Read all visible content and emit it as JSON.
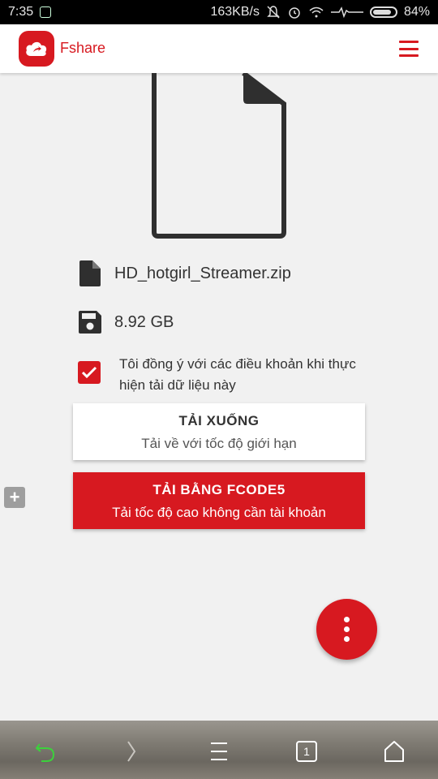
{
  "status_bar": {
    "time": "7:35",
    "network_speed": "163KB/s",
    "battery": "84%",
    "battery_level": 0.84,
    "icons": [
      "notification-icon",
      "mute-icon",
      "alarm-icon",
      "wifi-icon",
      "activity-icon",
      "battery-icon"
    ]
  },
  "header": {
    "brand": "Fshare",
    "logo_icon": "cloud-upload-icon",
    "menu_icon": "hamburger-menu-icon",
    "accent_color": "#d71920"
  },
  "file": {
    "name": "HD_hotgirl_Streamer.zip",
    "size": "8.92 GB",
    "name_icon": "file-icon",
    "size_icon": "save-icon"
  },
  "agreement": {
    "checked": true,
    "text": "Tôi đồng ý với các điều khoản khi thực hiện tải dữ liệu này"
  },
  "buttons": {
    "download": {
      "title": "TẢI XUỐNG",
      "subtitle": "Tải về với tốc độ giới hạn"
    },
    "fcode": {
      "title": "TẢI BẰNG FCODE5",
      "subtitle": "Tải tốc độ cao không cần tài khoản"
    }
  },
  "side_add": "+",
  "fab_icon": "more-vertical-icon",
  "bottom_nav": {
    "tab_count": "1",
    "icons": [
      "back-icon",
      "forward-icon",
      "menu-icon",
      "tabs-icon",
      "home-icon"
    ]
  }
}
